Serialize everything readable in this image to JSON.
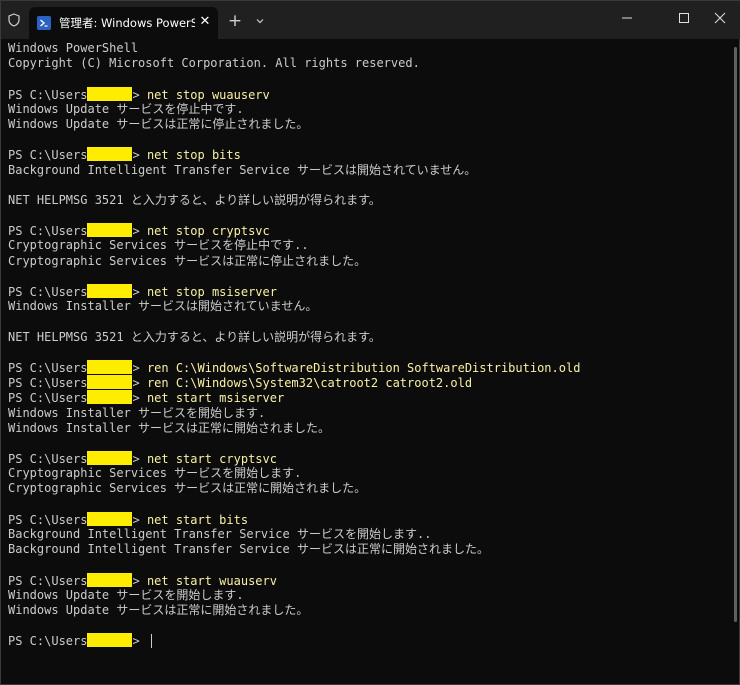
{
  "tab": {
    "title": "管理者: Windows PowerShe",
    "close_glyph": "✕",
    "new_tab_glyph": "+"
  },
  "terminal": {
    "prompt_prefix": "PS C:\\Users",
    "prompt_suffix": ">",
    "lines": [
      {
        "type": "text",
        "text": "Windows PowerShell"
      },
      {
        "type": "text",
        "text": "Copyright (C) Microsoft Corporation. All rights reserved."
      },
      {
        "type": "blank"
      },
      {
        "type": "prompt",
        "cmd": "net stop wuauserv"
      },
      {
        "type": "text",
        "text": "Windows Update サービスを停止中です."
      },
      {
        "type": "text",
        "text": "Windows Update サービスは正常に停止されました。"
      },
      {
        "type": "blank"
      },
      {
        "type": "prompt",
        "cmd": "net stop bits"
      },
      {
        "type": "text",
        "text": "Background Intelligent Transfer Service サービスは開始されていません。"
      },
      {
        "type": "blank"
      },
      {
        "type": "text",
        "text": "NET HELPMSG 3521 と入力すると、より詳しい説明が得られます。"
      },
      {
        "type": "blank"
      },
      {
        "type": "prompt",
        "cmd": "net stop cryptsvc"
      },
      {
        "type": "text",
        "text": "Cryptographic Services サービスを停止中です.."
      },
      {
        "type": "text",
        "text": "Cryptographic Services サービスは正常に停止されました。"
      },
      {
        "type": "blank"
      },
      {
        "type": "prompt",
        "cmd": "net stop msiserver"
      },
      {
        "type": "text",
        "text": "Windows Installer サービスは開始されていません。"
      },
      {
        "type": "blank"
      },
      {
        "type": "text",
        "text": "NET HELPMSG 3521 と入力すると、より詳しい説明が得られます。"
      },
      {
        "type": "blank"
      },
      {
        "type": "prompt",
        "cmd": "ren C:\\Windows\\SoftwareDistribution SoftwareDistribution.old"
      },
      {
        "type": "prompt",
        "cmd": "ren C:\\Windows\\System32\\catroot2 catroot2.old"
      },
      {
        "type": "prompt",
        "cmd": "net start msiserver"
      },
      {
        "type": "text",
        "text": "Windows Installer サービスを開始します."
      },
      {
        "type": "text",
        "text": "Windows Installer サービスは正常に開始されました。"
      },
      {
        "type": "blank"
      },
      {
        "type": "prompt",
        "cmd": "net start cryptsvc"
      },
      {
        "type": "text",
        "text": "Cryptographic Services サービスを開始します."
      },
      {
        "type": "text",
        "text": "Cryptographic Services サービスは正常に開始されました。"
      },
      {
        "type": "blank"
      },
      {
        "type": "prompt",
        "cmd": "net start bits"
      },
      {
        "type": "text",
        "text": "Background Intelligent Transfer Service サービスを開始します.."
      },
      {
        "type": "text",
        "text": "Background Intelligent Transfer Service サービスは正常に開始されました。"
      },
      {
        "type": "blank"
      },
      {
        "type": "prompt",
        "cmd": "net start wuauserv"
      },
      {
        "type": "text",
        "text": "Windows Update サービスを開始します."
      },
      {
        "type": "text",
        "text": "Windows Update サービスは正常に開始されました。"
      },
      {
        "type": "blank"
      },
      {
        "type": "prompt",
        "cmd": "",
        "cursor": true
      }
    ]
  },
  "colors": {
    "background": "#0c0c0c",
    "titlebar": "#202020",
    "text": "#cccccc",
    "command": "#f9f1a5",
    "redaction": "#ffed00",
    "powershell_icon": "#2b62c4"
  },
  "icons": {
    "shield": "shield-icon",
    "tab": "powershell-icon",
    "close_tab": "close-icon",
    "new_tab": "plus-icon",
    "dropdown": "chevron-down-icon",
    "minimize": "minimize-icon",
    "maximize": "maximize-icon",
    "close": "close-window-icon"
  }
}
